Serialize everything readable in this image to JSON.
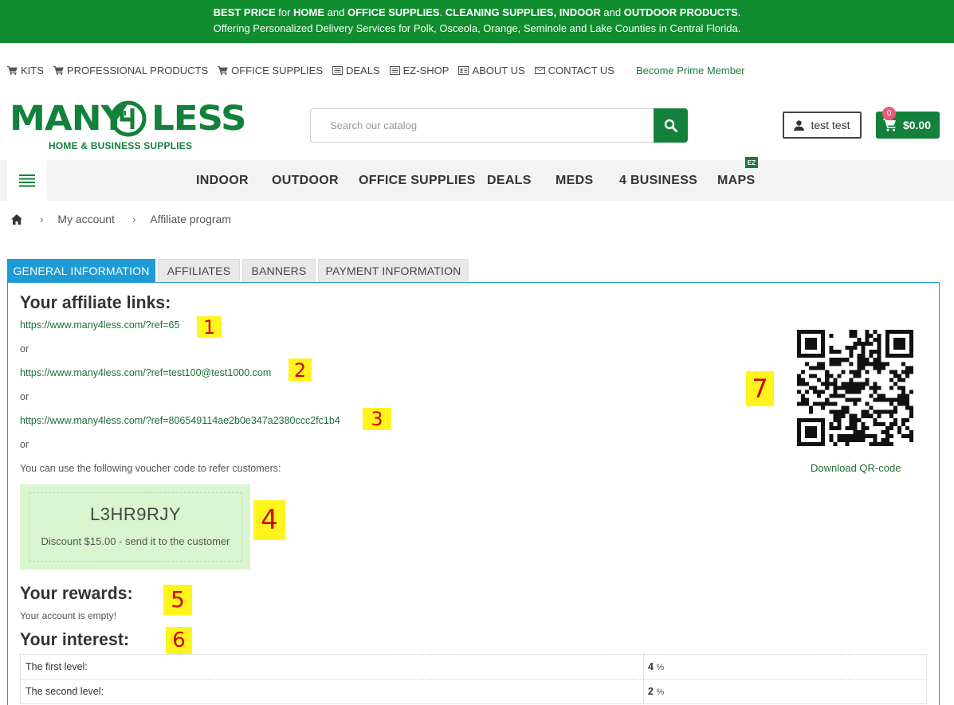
{
  "banner": {
    "l1_a": "BEST PRICE",
    "l1_b": " for ",
    "l1_c": "HOME",
    "l1_d": " and ",
    "l1_e": "OFFICE SUPPLIES",
    "l1_f": ". ",
    "l1_g": "CLEANING SUPPLIES, INDOOR",
    "l1_h": " and ",
    "l1_i": "OUTDOOR PRODUCTS",
    "l1_j": ".",
    "line2": "Offering Personalized Delivery Services for Polk, Osceola, Orange, Seminole and Lake Counties in Central Florida."
  },
  "secondary_nav": {
    "items": [
      {
        "label": "KITS",
        "icon": "cart-icon"
      },
      {
        "label": "PROFESSIONAL PRODUCTS",
        "icon": "cart-icon"
      },
      {
        "label": "OFFICE SUPPLIES",
        "icon": "cart-icon"
      },
      {
        "label": "DEALS",
        "icon": "list-icon"
      },
      {
        "label": "EZ-SHOP",
        "icon": "list-icon"
      },
      {
        "label": "ABOUT US",
        "icon": "id-card-icon"
      },
      {
        "label": "CONTACT US",
        "icon": "envelope-icon"
      }
    ],
    "prime": "Become Prime Member"
  },
  "logo": {
    "word_left": "MANY",
    "word_right": "LESS",
    "digit": "4",
    "tagline": "HOME & BUSINESS SUPPLIES"
  },
  "search": {
    "placeholder": "Search our catalog"
  },
  "user": {
    "name": "test test"
  },
  "cart": {
    "count": "0",
    "total": "$0.00"
  },
  "main_nav": {
    "items": [
      "INDOOR",
      "OUTDOOR",
      "OFFICE SUPPLIES",
      "DEALS",
      "MEDS",
      "4 BUSINESS",
      "MAPS"
    ],
    "badge": "EZ"
  },
  "breadcrumb": {
    "items": [
      "My account",
      "Affiliate program"
    ]
  },
  "tabs": [
    "GENERAL INFORMATION",
    "AFFILIATES",
    "BANNERS",
    "PAYMENT INFORMATION"
  ],
  "affiliate": {
    "heading": "Your affiliate links:",
    "links": [
      "https://www.many4less.com/?ref=65",
      "https://www.many4less.com/?ref=test100@test1000.com",
      "https://www.many4less.com/?ref=806549114ae2b0e347a2380ccc2fc1b4"
    ],
    "or": "or",
    "voucher_intro": "You can use the following voucher code to refer customers:",
    "voucher_code": "L3HR9RJY",
    "voucher_desc": "Discount $15.00 - send it to the customer",
    "qr_download": "Download QR-code"
  },
  "rewards": {
    "heading": "Your rewards:",
    "text": "Your account is empty!"
  },
  "interest": {
    "heading": "Your interest:",
    "rows": [
      {
        "label": "The first level:",
        "value": "4",
        "unit": "%"
      },
      {
        "label": "The second level:",
        "value": "2",
        "unit": "%"
      }
    ]
  },
  "markers": [
    "1",
    "2",
    "3",
    "4",
    "5",
    "6",
    "7"
  ],
  "colors": {
    "brand_green": "#13813b",
    "banner_green": "#108d2f",
    "tab_active": "#1d9bd6",
    "voucher_bg": "#d9f5d0",
    "marker_yellow": "#fff51d",
    "marker_red": "#d40000"
  }
}
